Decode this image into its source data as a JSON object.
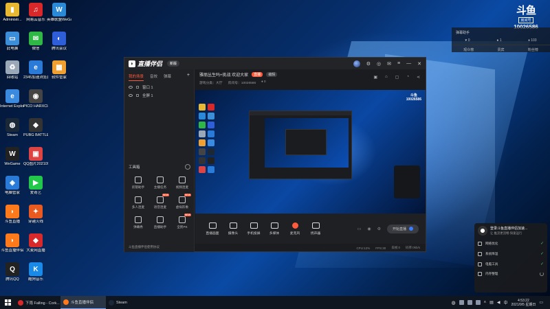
{
  "desktop": {
    "icons": [
      {
        "label": "Administr...",
        "color": "#e8b832",
        "glyph": "▮"
      },
      {
        "label": "网易云音乐",
        "color": "#d8282a",
        "glyph": "♫"
      },
      {
        "label": "英雄联盟WeGame",
        "color": "#2a8ad8",
        "glyph": "W"
      },
      {
        "label": "此电脑",
        "color": "#3c8ed8",
        "glyph": "▭"
      },
      {
        "label": "微信",
        "color": "#2fb845",
        "glyph": "✉"
      },
      {
        "label": "腾讯会议",
        "color": "#2f5fd8",
        "glyph": "◐"
      },
      {
        "label": "回收站",
        "color": "#9aa8b8",
        "glyph": "♻"
      },
      {
        "label": "2345加速浏览器",
        "color": "#2a7ad8",
        "glyph": "e"
      },
      {
        "label": "软件管家",
        "color": "#f0a030",
        "glyph": "▦"
      },
      {
        "label": "Internet Explorer",
        "color": "#3a8ae0",
        "glyph": "e"
      },
      {
        "label": "PICO HARXClass...",
        "color": "#444444",
        "glyph": "◉"
      },
      {
        "label": "Steam",
        "color": "#1b2838",
        "glyph": "◍"
      },
      {
        "label": "PUBG BATTLEGR...",
        "color": "#333333",
        "glyph": "◆"
      },
      {
        "label": "WeGame",
        "color": "#222222",
        "glyph": "W"
      },
      {
        "label": "QQ图片20210901...",
        "color": "#dd4444",
        "glyph": "▣"
      },
      {
        "label": "电脑管家",
        "color": "#2a7ad8",
        "glyph": "◈"
      },
      {
        "label": "爱奇艺",
        "color": "#22c84a",
        "glyph": "▶"
      },
      {
        "label": "斗鱼直播",
        "color": "#ff7a1a",
        "glyph": "◗"
      },
      {
        "label": "穿越火线",
        "color": "#e85a20",
        "glyph": "✦"
      },
      {
        "label": "斗鱼直播伴侣",
        "color": "#ff7a1a",
        "glyph": "◗"
      },
      {
        "label": "大麦网直播",
        "color": "#d82a2a",
        "glyph": "◆"
      },
      {
        "label": "腾讯QQ",
        "color": "#222222",
        "glyph": "Q"
      },
      {
        "label": "酷狗音乐",
        "color": "#1a8ae8",
        "glyph": "K"
      }
    ]
  },
  "app": {
    "name": "直播伴侣",
    "version": "新版",
    "left_tabs": [
      "我的场景",
      "音效",
      "弹幕"
    ],
    "scenes": [
      "窗口 1",
      "全屏 1"
    ],
    "toolbox_title": "工具箱",
    "tools": [
      {
        "label": "房管助手",
        "new": false
      },
      {
        "label": "主播任务",
        "new": false
      },
      {
        "label": "视频连麦",
        "new": false
      },
      {
        "label": "多人连麦",
        "new": false
      },
      {
        "label": "语音连麦",
        "new": true
      },
      {
        "label": "虚拟形象",
        "new": true
      },
      {
        "label": "弹幕秀",
        "new": false
      },
      {
        "label": "直播助手",
        "new": false
      },
      {
        "label": "全民PK",
        "new": true
      }
    ],
    "left_notice": "斗鱼直播伴侣使用协议",
    "room": {
      "title": "雅丽丛生吗+挑战 欢迎大家",
      "live_badge": "直播",
      "edit_badge": "编辑",
      "category": "游戏分类：大厅",
      "room_label": "房间号：10026586",
      "hot": "0"
    },
    "bottom_buttons": [
      "直播画面",
      "摄像头",
      "手机投屏",
      "多媒体",
      "麦克风",
      "扬声器"
    ],
    "go_live_label": "开始直播",
    "status": [
      "CPU:12%",
      "FPS:30",
      "丢帧:0",
      "码率:0kb/s"
    ]
  },
  "sidebar": {
    "header": "弹幕助手",
    "stats": [
      "0",
      "1",
      "103"
    ],
    "tabs": [
      "观众榜",
      "贵宾",
      "粉丝榜"
    ]
  },
  "brand": {
    "logo_text": "斗鱼",
    "room_box": "房间号",
    "room_number": "10026586"
  },
  "popup": {
    "title": "登录斗鱼直播伴侣加速...",
    "subtitle": "让 推流更流畅 快速运行",
    "rows": [
      {
        "label": "网络优化",
        "state": "done"
      },
      {
        "label": "系统降温",
        "state": "done"
      },
      {
        "label": "电脑工具",
        "state": "done"
      },
      {
        "label": "内存整理",
        "state": "loading"
      }
    ]
  },
  "taskbar": {
    "items": [
      {
        "label": "下雨 Falling - Cork...",
        "color": "#d8282a",
        "active": false
      },
      {
        "label": "斗鱼直播伴侣",
        "color": "#ff7a1a",
        "active": true
      },
      {
        "label": "Steam",
        "color": "#1b2838",
        "active": false
      }
    ],
    "time": "4:53:22",
    "date": "2021/9/5 星期日",
    "ime": "中"
  }
}
